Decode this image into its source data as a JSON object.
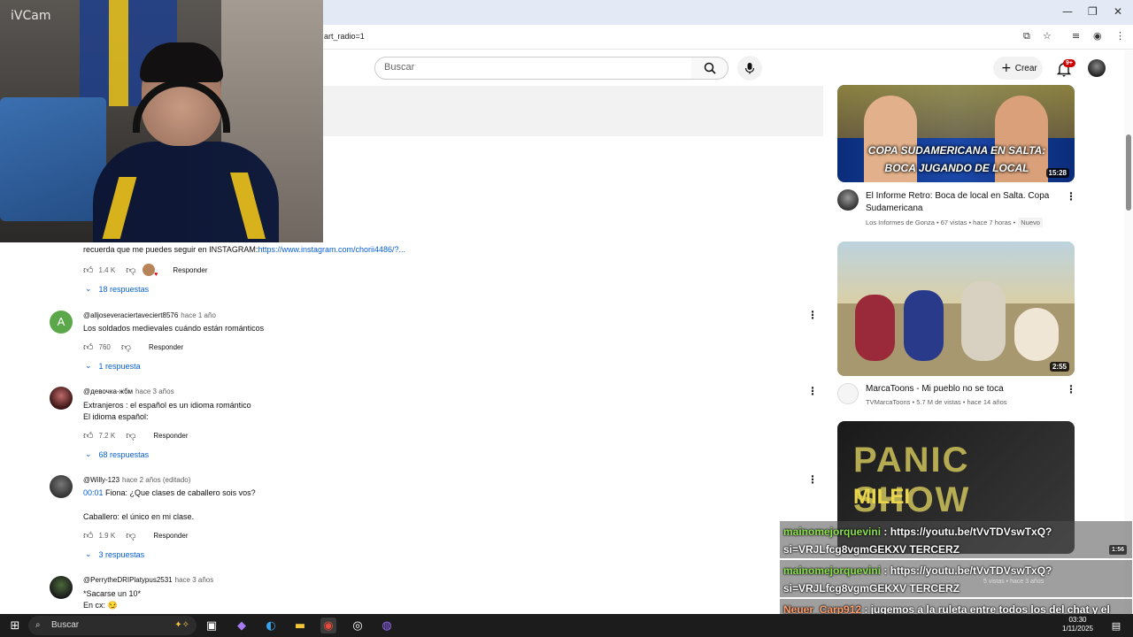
{
  "browser": {
    "url": "art_radio=1",
    "window_controls": [
      "—",
      "❐",
      "✕"
    ]
  },
  "webcam": {
    "label": "iVCam"
  },
  "header": {
    "search_placeholder": "Buscar",
    "create_label": "Crear",
    "notifications_badge": "9+"
  },
  "comments": [
    {
      "text_prefix": "recuerda que me puedes seguir en INSTAGRAM:",
      "link": "https://www.instagram.com/chorii4486/?...",
      "likes": "1.4 K",
      "reply_label": "Responder",
      "replies": "18 respuestas"
    },
    {
      "author": "@alljoseveraciertaveciert8576",
      "time": "hace 1 año",
      "text": "Los soldados medievales cuándo están románticos",
      "likes": "760",
      "reply_label": "Responder",
      "replies": "1 respuesta"
    },
    {
      "author": "@девочка-жбм",
      "time": "hace 3 años",
      "line1": "Extranjeros : el español es un idioma romántico",
      "line2": "El idioma español:",
      "likes": "7.2 K",
      "reply_label": "Responder",
      "replies": "68 respuestas"
    },
    {
      "author": "@Willy-123",
      "time": "hace 2 años (editado)",
      "timestamp": "00:01",
      "line1": " Fiona: ¿Que clases de caballero sois vos?",
      "line2": "Caballero: el único en mi clase.",
      "likes": "1.9 K",
      "reply_label": "Responder",
      "replies": "3 respuestas"
    },
    {
      "author": "@PerrytheDRIPlatypus2531",
      "time": "hace 3 años",
      "line1": "*Sacarse un 10*",
      "line2": "En cx: 😏"
    }
  ],
  "sidebar": {
    "videos": [
      {
        "thumb_text": "COPA SUDAMERICANA EN SALTA: BOCA JUGANDO DE LOCAL",
        "duration": "15:28",
        "title": "El Informe Retro: Boca de local en Salta. Copa Sudamericana",
        "channel": "Los Informes de Gonza",
        "views": "67 vistas",
        "age": "hace 7 horas",
        "badge": "Nuevo"
      },
      {
        "duration": "2:55",
        "title": "MarcaToons - Mi pueblo no se toca",
        "channel": "TVMarcaToons",
        "views": "5.7 M de vistas",
        "age": "hace 14 años"
      },
      {
        "thumb_text_big": "PANIC SHOW",
        "thumb_text_small": "MILEI"
      }
    ]
  },
  "chat": [
    {
      "user": "mainomejorquevini",
      "message": " : https://youtu.be/tVvTDVswTxQ?si=VRJLfcg8vgmGEKXV TERCERZ",
      "duration_overlay": "1:56"
    },
    {
      "user": "mainomejorquevini",
      "message": " : https://youtu.be/tVvTDVswTxQ?si=VRJLfcg8vgmGEKXV TERCERZ",
      "meta_overlay": "5 vistas • hace 3 años"
    },
    {
      "user": "Neuer_Carp912",
      "message": " : jugemos a la ruleta entre todos los del chat y el que pierde manda la foto de cavani en mejor a memes"
    }
  ],
  "taskbar": {
    "search_label": "Buscar",
    "time": "03:30",
    "date": "1/11/2025"
  }
}
